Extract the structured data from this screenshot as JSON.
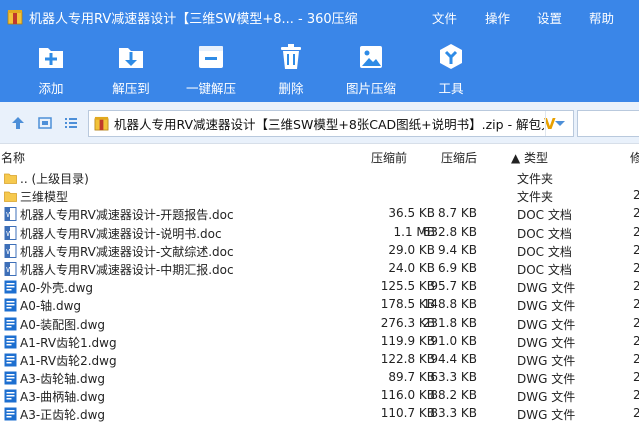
{
  "window": {
    "title": "机器人专用RV减速器设计【三维SW模型+8... - 360压缩",
    "menu": [
      "文件",
      "操作",
      "设置",
      "帮助"
    ]
  },
  "toolbar": {
    "items": [
      {
        "label": "添加",
        "icon": "add-icon"
      },
      {
        "label": "解压到",
        "icon": "extract-to-icon"
      },
      {
        "label": "一键解压",
        "icon": "one-click-extract-icon"
      },
      {
        "label": "删除",
        "icon": "trash-icon"
      },
      {
        "label": "图片压缩",
        "icon": "image-compress-icon"
      },
      {
        "label": "工具",
        "icon": "tools-icon"
      }
    ],
    "colors": {
      "bar": "#3a86e8",
      "icon_fill": "#ffffff",
      "icon_accent": "#2e8be6"
    }
  },
  "address": {
    "path": "机器人专用RV减速器设计【三维SW模型+8张CAD图纸+说明书】.zip - 解包大小为",
    "mark": "V"
  },
  "columns": {
    "name": "名称",
    "size": "压缩前",
    "packed": "压缩后",
    "type": "▲ 类型",
    "extra": "修"
  },
  "files": [
    {
      "icon": "folder-icon",
      "name": ".. (上级目录)",
      "size": "",
      "packed": "",
      "type": "文件夹",
      "extra": ""
    },
    {
      "icon": "folder-icon",
      "name": "三维模型",
      "size": "",
      "packed": "",
      "type": "文件夹",
      "extra": "2"
    },
    {
      "icon": "doc-icon",
      "name": "机器人专用RV减速器设计-开题报告.doc",
      "size": "36.5 KB",
      "packed": "8.7 KB",
      "type": "DOC 文档",
      "extra": "2"
    },
    {
      "icon": "doc-icon",
      "name": "机器人专用RV减速器设计-说明书.doc",
      "size": "1.1 MB",
      "packed": "632.8 KB",
      "type": "DOC 文档",
      "extra": "2"
    },
    {
      "icon": "doc-icon",
      "name": "机器人专用RV减速器设计-文献综述.doc",
      "size": "29.0 KB",
      "packed": "9.4 KB",
      "type": "DOC 文档",
      "extra": "2"
    },
    {
      "icon": "doc-icon",
      "name": "机器人专用RV减速器设计-中期汇报.doc",
      "size": "24.0 KB",
      "packed": "6.9 KB",
      "type": "DOC 文档",
      "extra": "2"
    },
    {
      "icon": "dwg-icon",
      "name": "A0-外壳.dwg",
      "size": "125.5 KB",
      "packed": "95.7 KB",
      "type": "DWG 文件",
      "extra": "2"
    },
    {
      "icon": "dwg-icon",
      "name": "A0-轴.dwg",
      "size": "178.5 KB",
      "packed": "148.8 KB",
      "type": "DWG 文件",
      "extra": "2"
    },
    {
      "icon": "dwg-icon",
      "name": "A0-装配图.dwg",
      "size": "276.3 KB",
      "packed": "231.8 KB",
      "type": "DWG 文件",
      "extra": "2"
    },
    {
      "icon": "dwg-icon",
      "name": "A1-RV齿轮1.dwg",
      "size": "119.9 KB",
      "packed": "91.0 KB",
      "type": "DWG 文件",
      "extra": "2"
    },
    {
      "icon": "dwg-icon",
      "name": "A1-RV齿轮2.dwg",
      "size": "122.8 KB",
      "packed": "94.4 KB",
      "type": "DWG 文件",
      "extra": "2"
    },
    {
      "icon": "dwg-icon",
      "name": "A3-齿轮轴.dwg",
      "size": "89.7 KB",
      "packed": "63.3 KB",
      "type": "DWG 文件",
      "extra": "2"
    },
    {
      "icon": "dwg-icon",
      "name": "A3-曲柄轴.dwg",
      "size": "116.0 KB",
      "packed": "88.2 KB",
      "type": "DWG 文件",
      "extra": "2"
    },
    {
      "icon": "dwg-icon",
      "name": "A3-正齿轮.dwg",
      "size": "110.7 KB",
      "packed": "83.3 KB",
      "type": "DWG 文件",
      "extra": "2"
    }
  ]
}
